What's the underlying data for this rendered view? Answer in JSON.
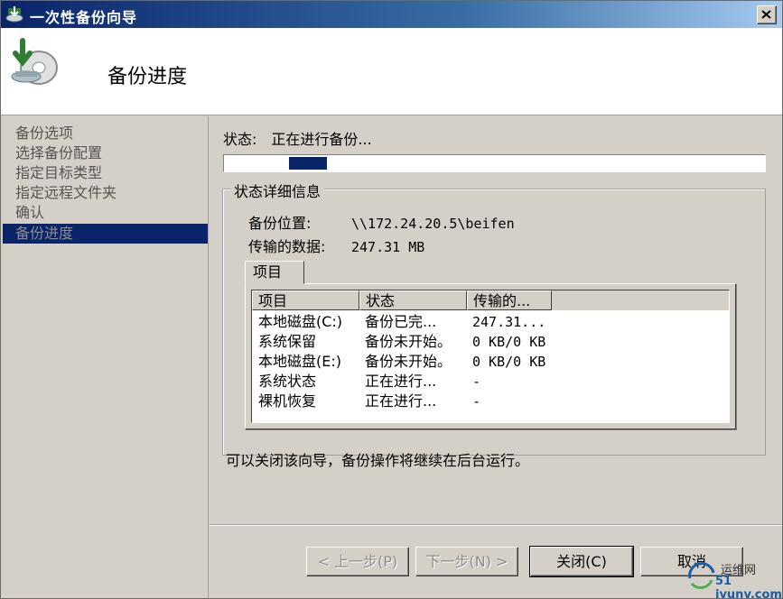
{
  "window": {
    "title": "一次性备份向导"
  },
  "header": {
    "title": "备份进度"
  },
  "nav": {
    "items": [
      {
        "label": "备份选项",
        "active": false
      },
      {
        "label": "选择备份配置",
        "active": false
      },
      {
        "label": "指定目标类型",
        "active": false
      },
      {
        "label": "指定远程文件夹",
        "active": false
      },
      {
        "label": "确认",
        "active": false
      },
      {
        "label": "备份进度",
        "active": true
      }
    ]
  },
  "status": {
    "label": "状态:",
    "value": "正在进行备份...",
    "progress_start_fraction": 0.12,
    "progress_end_fraction": 0.19
  },
  "details": {
    "legend": "状态详细信息",
    "location_label": "备份位置:",
    "location_value": "\\\\172.24.20.5\\beifen",
    "transferred_label": "传输的数据:",
    "transferred_value": "247.31 MB",
    "tab_label": "项目",
    "columns": [
      "项目",
      "状态",
      "传输的..."
    ],
    "rows": [
      [
        "本地磁盘(C:)",
        "备份已完...",
        "247.31..."
      ],
      [
        "系统保留",
        "备份未开始。",
        "0 KB/0 KB"
      ],
      [
        "本地磁盘(E:)",
        "备份未开始。",
        "0 KB/0 KB"
      ],
      [
        "系统状态",
        "正在进行...",
        "-"
      ],
      [
        "裸机恢复",
        "正在进行...",
        "-"
      ]
    ]
  },
  "hint": "可以关闭该向导，备份操作将继续在后台运行。",
  "buttons": {
    "prev": "< 上一步(P)",
    "next": "下一步(N) >",
    "close": "关闭(C)",
    "cancel": "取消"
  },
  "watermark": {
    "text": "运维网",
    "sub": "iyunv.com",
    "prefix": "51"
  },
  "colors": {
    "accent": "#0a246a",
    "face": "#d4d0c8"
  }
}
